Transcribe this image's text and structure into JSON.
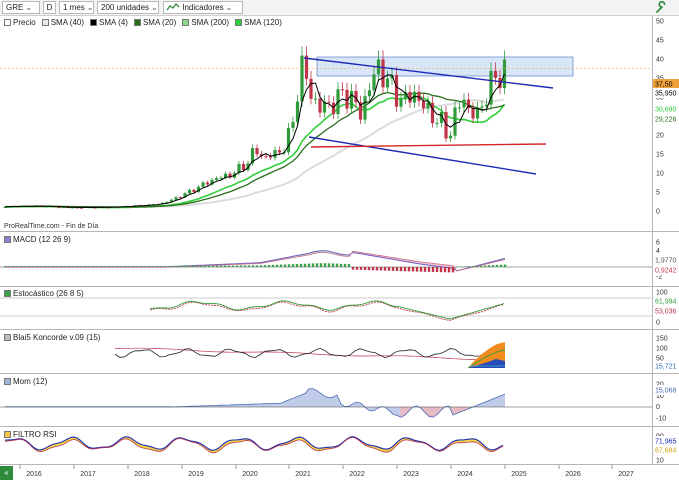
{
  "toolbar": {
    "symbol": "GRE",
    "symbol_letter": "D",
    "period": "1 mes",
    "units": "200 unidades",
    "indicators": "Indicadores"
  },
  "colors": {
    "up_candle": "#2f9b3a",
    "down_candle": "#c0344a",
    "sma40": "#f0f0f0",
    "sma4": "#000000",
    "sma20": "#2a6e1c",
    "sma200": "#8bd68b",
    "sma120": "#2fcf3a",
    "channel": "#1b2bb5",
    "support": "#d32525",
    "resistance_box": "#cfe0f7"
  },
  "price_panel": {
    "legend": [
      "Precio",
      "SMA (40)",
      "SMA (4)",
      "SMA (20)",
      "SMA (200)",
      "SMA (120)"
    ],
    "source": "ProRealTime.com - Fin de Día",
    "axis_ticks": [
      "50",
      "45",
      "40",
      "35",
      "30",
      "25",
      "20",
      "15",
      "10",
      "5",
      "0"
    ],
    "last_price": "37,50",
    "tags": [
      "35,950",
      "30,680",
      "29,226"
    ]
  },
  "macd_panel": {
    "label": "MACD (12 26 9)",
    "axis_ticks": [
      "6",
      "4",
      "2",
      "0",
      "-2"
    ],
    "tags": [
      "1,9770",
      "0,9242"
    ]
  },
  "stoch_panel": {
    "label": "Estocástico (26 8 5)",
    "axis_ticks": [
      "100",
      "80",
      "20",
      "0"
    ],
    "tags": [
      "61,994",
      "53,036"
    ]
  },
  "koncorde_panel": {
    "label": "Blai5 Koncorde v.09 (15)",
    "axis_ticks": [
      "150",
      "100",
      "50",
      "0"
    ],
    "tags": [
      "15,721"
    ]
  },
  "mom_panel": {
    "label": "Mom (12)",
    "axis_ticks": [
      "20",
      "10",
      "0",
      "-10"
    ],
    "tags": [
      "15,068"
    ]
  },
  "rsi_panel": {
    "label": "FILTRO RSI",
    "axis_ticks": [
      "90",
      "50",
      "10"
    ],
    "tags": [
      "71,965",
      "67,684"
    ]
  },
  "x_axis": {
    "years": [
      "2016",
      "2017",
      "2018",
      "2019",
      "2020",
      "2021",
      "2022",
      "2023",
      "2024",
      "2025",
      "2026",
      "2027"
    ]
  }
}
